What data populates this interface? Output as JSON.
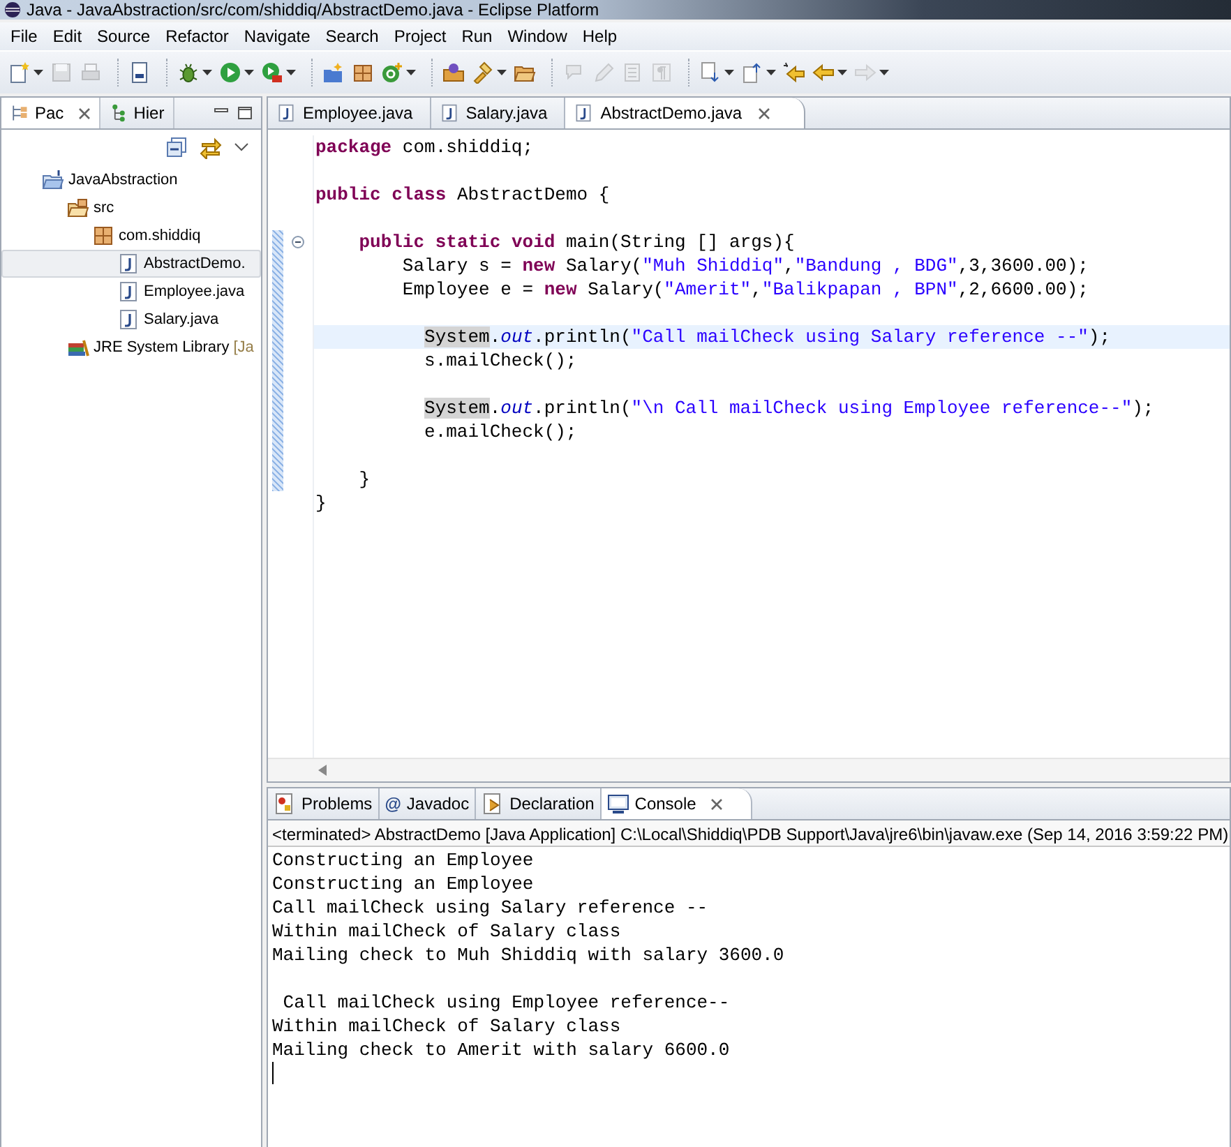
{
  "window": {
    "title": "Java - JavaAbstraction/src/com/shiddiq/AbstractDemo.java - Eclipse Platform"
  },
  "menu": [
    "File",
    "Edit",
    "Source",
    "Refactor",
    "Navigate",
    "Search",
    "Project",
    "Run",
    "Window",
    "Help"
  ],
  "toolbar": [
    [
      {
        "kind": "new",
        "disabled": false,
        "dropdown": true
      },
      {
        "kind": "save",
        "disabled": true,
        "dropdown": false
      },
      {
        "kind": "print",
        "disabled": true,
        "dropdown": false
      }
    ],
    [
      {
        "kind": "binary",
        "disabled": false,
        "dropdown": false
      }
    ],
    [
      {
        "kind": "debug",
        "disabled": false,
        "dropdown": true
      },
      {
        "kind": "run",
        "disabled": false,
        "dropdown": true
      },
      {
        "kind": "tools",
        "disabled": false,
        "dropdown": true
      }
    ],
    [
      {
        "kind": "package",
        "disabled": false,
        "dropdown": false
      },
      {
        "kind": "class",
        "disabled": false,
        "dropdown": false
      },
      {
        "kind": "classplus",
        "disabled": false,
        "dropdown": true
      }
    ],
    [
      {
        "kind": "type",
        "disabled": false,
        "dropdown": false
      },
      {
        "kind": "search",
        "disabled": false,
        "dropdown": true
      },
      {
        "kind": "folder",
        "disabled": false,
        "dropdown": false
      }
    ],
    [
      {
        "kind": "comment",
        "disabled": true,
        "dropdown": false
      },
      {
        "kind": "pen",
        "disabled": true,
        "dropdown": false
      },
      {
        "kind": "block",
        "disabled": true,
        "dropdown": false
      },
      {
        "kind": "pilcrow",
        "disabled": true,
        "dropdown": false
      }
    ],
    [
      {
        "kind": "next",
        "disabled": false,
        "dropdown": true
      },
      {
        "kind": "prev",
        "disabled": false,
        "dropdown": true
      },
      {
        "kind": "lastedit",
        "disabled": false,
        "dropdown": false
      },
      {
        "kind": "back",
        "disabled": false,
        "dropdown": true
      },
      {
        "kind": "forward",
        "disabled": true,
        "dropdown": true
      }
    ]
  ],
  "explorer": {
    "tabs": [
      {
        "label": "Pac",
        "kind": "packages",
        "selected": true
      },
      {
        "label": "Hier",
        "kind": "hierarchy",
        "selected": false
      }
    ],
    "tree": [
      {
        "label": "JavaAbstraction",
        "kind": "project",
        "selected": false,
        "children": [
          {
            "label": "src",
            "kind": "folder",
            "selected": false,
            "children": [
              {
                "label": "com.shiddiq",
                "kind": "package",
                "selected": false,
                "children": [
                  {
                    "label": "AbstractDemo.",
                    "kind": "java",
                    "selected": true
                  },
                  {
                    "label": "Employee.java",
                    "kind": "java",
                    "selected": false
                  },
                  {
                    "label": "Salary.java",
                    "kind": "java",
                    "selected": false
                  }
                ]
              }
            ]
          },
          {
            "label": "JRE System Library",
            "decoration": "[Ja",
            "kind": "library",
            "selected": false
          }
        ]
      }
    ]
  },
  "editor": {
    "tabs": [
      {
        "label": "Employee.java",
        "selected": false
      },
      {
        "label": "Salary.java",
        "selected": false
      },
      {
        "label": "AbstractDemo.java",
        "selected": true
      }
    ],
    "lines": [
      {
        "current": false,
        "changed": false,
        "segments": [
          {
            "kind": "keyword",
            "text": "package"
          },
          {
            "kind": "plain",
            "text": " com.shiddiq;"
          }
        ]
      },
      {
        "current": false,
        "changed": false
      },
      {
        "current": false,
        "changed": false,
        "segments": [
          {
            "kind": "keyword",
            "text": "public"
          },
          {
            "kind": "keyword",
            "text": " class"
          },
          {
            "kind": "plain",
            "text": " AbstractDemo {"
          }
        ]
      },
      {
        "current": false,
        "changed": false
      },
      {
        "current": false,
        "changed": true,
        "fold_expanded": true,
        "segments": [
          {
            "kind": "keyword",
            "text": "    public"
          },
          {
            "kind": "keyword",
            "text": " static"
          },
          {
            "kind": "keyword",
            "text": " void"
          },
          {
            "kind": "plain",
            "text": " main(String [] args){"
          }
        ]
      },
      {
        "current": false,
        "changed": true,
        "segments": [
          {
            "kind": "plain",
            "text": "        Salary s = "
          },
          {
            "kind": "keyword",
            "text": "new"
          },
          {
            "kind": "plain",
            "text": " Salary("
          },
          {
            "kind": "string",
            "text": "\"Muh Shiddiq\""
          },
          {
            "kind": "plain",
            "text": ","
          },
          {
            "kind": "string",
            "text": "\"Bandung , BDG\""
          },
          {
            "kind": "plain",
            "text": ",3,3600.00);"
          }
        ]
      },
      {
        "current": false,
        "changed": true,
        "segments": [
          {
            "kind": "plain",
            "text": "        Employee e = "
          },
          {
            "kind": "keyword",
            "text": "new"
          },
          {
            "kind": "plain",
            "text": " Salary("
          },
          {
            "kind": "string",
            "text": "\"Amerit\""
          },
          {
            "kind": "plain",
            "text": ","
          },
          {
            "kind": "string",
            "text": "\"Balikpapan , BPN\""
          },
          {
            "kind": "plain",
            "text": ",2,6600.00);"
          }
        ]
      },
      {
        "current": false,
        "changed": true
      },
      {
        "current": true,
        "changed": true,
        "segments": [
          {
            "kind": "occurrence",
            "text": "          System"
          },
          {
            "kind": "plain",
            "text": "."
          },
          {
            "kind": "field",
            "text": "out"
          },
          {
            "kind": "plain",
            "text": ".println("
          },
          {
            "kind": "string",
            "text": "\"Call mailCheck using Salary reference --\""
          },
          {
            "kind": "plain",
            "text": ");"
          }
        ]
      },
      {
        "current": false,
        "changed": true,
        "segments": [
          {
            "kind": "plain",
            "text": "          s.mailCheck();"
          }
        ]
      },
      {
        "current": false,
        "changed": true
      },
      {
        "current": false,
        "changed": true,
        "segments": [
          {
            "kind": "occurrence",
            "text": "          System"
          },
          {
            "kind": "plain",
            "text": "."
          },
          {
            "kind": "field",
            "text": "out"
          },
          {
            "kind": "plain",
            "text": ".println("
          },
          {
            "kind": "string",
            "text": "\"\\n Call mailCheck using Employee reference--\""
          },
          {
            "kind": "plain",
            "text": ");"
          }
        ]
      },
      {
        "current": false,
        "changed": true,
        "segments": [
          {
            "kind": "plain",
            "text": "          e.mailCheck();"
          }
        ]
      },
      {
        "current": false,
        "changed": true
      },
      {
        "current": false,
        "changed": true,
        "segments": [
          {
            "kind": "plain",
            "text": "    }"
          }
        ]
      },
      {
        "current": false,
        "changed": false,
        "segments": [
          {
            "kind": "plain",
            "text": "}"
          }
        ]
      }
    ]
  },
  "console_view": {
    "tabs": [
      {
        "label": "Problems",
        "kind": "problems",
        "selected": false
      },
      {
        "label": "Javadoc",
        "kind": "javadoc",
        "glyph": "@",
        "selected": false
      },
      {
        "label": "Declaration",
        "kind": "declaration",
        "selected": false
      },
      {
        "label": "Console",
        "kind": "console",
        "selected": true
      }
    ],
    "header": "<terminated> AbstractDemo [Java Application] C:\\Local\\Shiddiq\\PDB Support\\Java\\jre6\\bin\\javaw.exe (Sep 14, 2016 3:59:22 PM)",
    "output_blocks": [
      [
        "Constructing an Employee",
        "Constructing an Employee",
        "Call mailCheck using Salary reference --",
        "Within mailCheck of Salary class",
        "Mailing check to Muh Shiddiq with salary 3600.0"
      ],
      [
        " Call mailCheck using Employee reference--",
        "Within mailCheck of Salary class",
        "Mailing check to Amerit with salary 6600.0"
      ]
    ]
  }
}
